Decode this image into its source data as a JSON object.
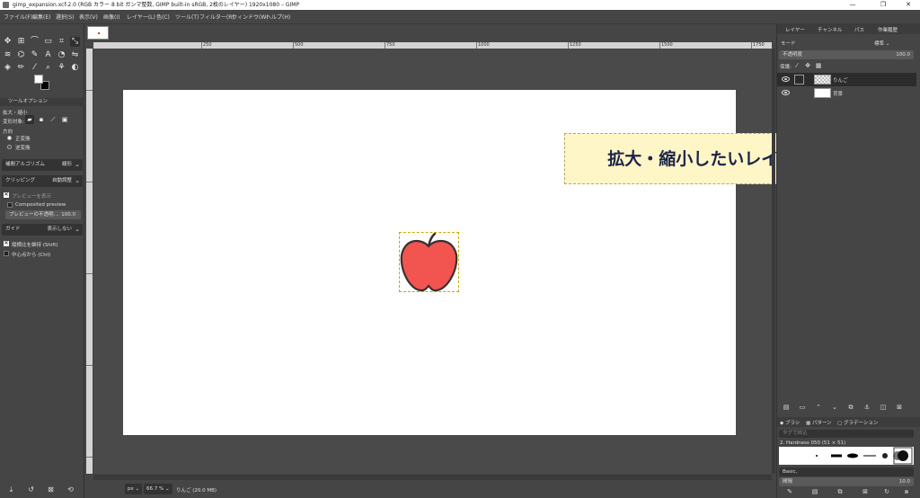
{
  "window": {
    "title": "gimp_expansion.xcf-2.0 (RGB カラー 8 bit ガンマ整数, GIMP built-in sRGB, 2枚のレイヤー) 1920x1080 – GIMP",
    "minimize": "—",
    "maximize": "❐",
    "close": "✕"
  },
  "menu": [
    {
      "label": "ファイル(F)"
    },
    {
      "label": "編集(E)"
    },
    {
      "label": "選択(S)"
    },
    {
      "label": "表示(V)"
    },
    {
      "label": "画像(I)"
    },
    {
      "label": "レイヤー(L)"
    },
    {
      "label": "色(C)"
    },
    {
      "label": "ツール(T)"
    },
    {
      "label": "フィルター(R)"
    },
    {
      "label": "ウィンドウ(W)"
    },
    {
      "label": "ヘルプ(H)"
    }
  ],
  "tool_options": {
    "tab_label": "ツールオプション",
    "tool_name": "拡大・縮小",
    "transform_label": "変形対象:",
    "direction_label": "方向",
    "direction_normal": "正変換",
    "direction_reverse": "逆変換",
    "interpolation_label": "補間アルゴリズム",
    "interpolation_value": "線形",
    "clipping_label": "クリッピング",
    "clipping_value": "自動調整",
    "show_preview": "プレビューを表示",
    "composited_preview": "Composited preview",
    "preview_opacity_label": "プレビューの不透明…",
    "preview_opacity_value": "100.0",
    "guide_label": "ガイド",
    "guide_value": "表示しない",
    "keep_aspect": "縦横比を維持 (Shift)",
    "from_center": "中心点から (Ctrl)"
  },
  "ruler": {
    "top_labels": [
      "250",
      "500",
      "750",
      "1000",
      "1250",
      "1500",
      "1750"
    ]
  },
  "callout": {
    "text": "拡大・縮小したいレイヤーを選択"
  },
  "status": {
    "unit": "px",
    "zoom": "66.7 %",
    "info": "りんご (20.0 MB)"
  },
  "dock": {
    "tabs": [
      "レイヤー",
      "チャンネル",
      "パス",
      "作業履歴"
    ],
    "mode_label": "モード",
    "mode_value": "標準",
    "opacity_label": "不透明度",
    "opacity_value": "100.0",
    "lock_label": "保護:",
    "layers": [
      {
        "name": "りんご",
        "selected": true
      },
      {
        "name": "背景",
        "selected": false
      }
    ],
    "brush_tabs": [
      "ブラシ",
      "パターン",
      "グラデーション"
    ],
    "brush_filter_placeholder": "タグで絞込",
    "brush_name": "2. Hardness 050 (51 × 51)",
    "brush_tag": "Basic,",
    "spacing_label": "間隔",
    "spacing_value": "10.0"
  },
  "colors": {
    "apple_fill": "#f2544f",
    "apple_outline": "#3a3030",
    "callout_bg": "#fff6c8",
    "callout_text": "#1c2447"
  }
}
